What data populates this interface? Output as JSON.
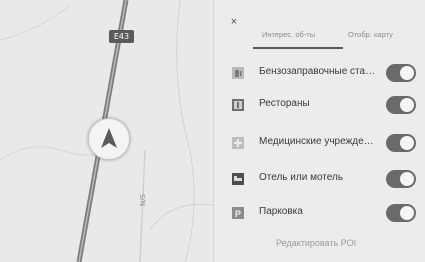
{
  "map": {
    "road_shield": "E43",
    "road_label": "N/S",
    "vehicle_icon": "navigation-arrow-icon"
  },
  "panel": {
    "close_label": "×",
    "tabs": [
      {
        "label": "Интерес. об-ты"
      },
      {
        "label": "Отобр. карту"
      }
    ],
    "items": [
      {
        "label": "Бензозаправочные ста…",
        "icon": "gas-station-icon",
        "enabled": true
      },
      {
        "label": "Рестораны",
        "icon": "restaurant-icon",
        "enabled": true
      },
      {
        "label": "Медицинские учрежде…",
        "icon": "medical-icon",
        "enabled": true
      },
      {
        "label": "Отель или мотель",
        "icon": "hotel-icon",
        "enabled": true
      },
      {
        "label": "Парковка",
        "icon": "parking-icon",
        "enabled": true
      }
    ],
    "footer_button": "Редактировать POI"
  },
  "colors": {
    "toggle_on": "#6a6a6a",
    "panel_bg": "#ececea",
    "map_bg": "#e9eae8"
  }
}
